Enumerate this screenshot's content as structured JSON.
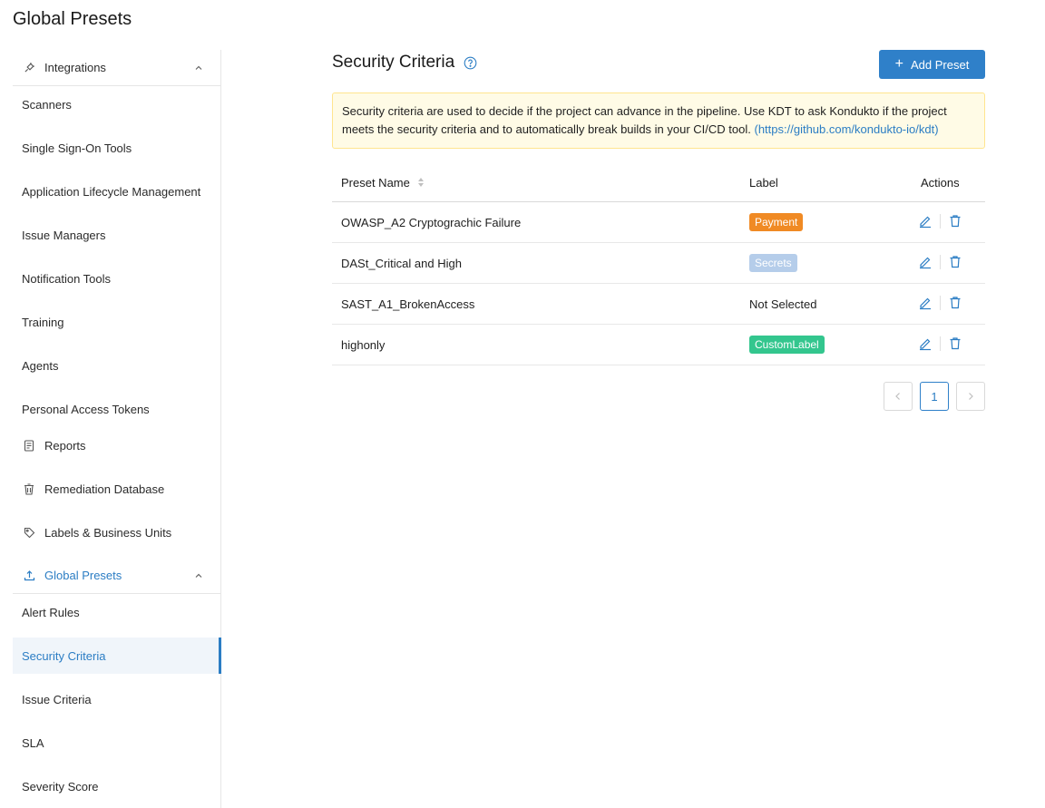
{
  "page": {
    "title": "Global Presets"
  },
  "sidebar": {
    "items": [
      {
        "label": "Integrations",
        "type": "group",
        "icon": "plug-icon"
      },
      {
        "label": "Scanners",
        "type": "sub"
      },
      {
        "label": "Single Sign-On Tools",
        "type": "sub"
      },
      {
        "label": "Application Lifecycle Management",
        "type": "sub"
      },
      {
        "label": "Issue Managers",
        "type": "sub"
      },
      {
        "label": "Notification Tools",
        "type": "sub"
      },
      {
        "label": "Training",
        "type": "sub"
      },
      {
        "label": "Agents",
        "type": "sub"
      },
      {
        "label": "Personal Access Tokens",
        "type": "sub"
      },
      {
        "label": "Reports",
        "type": "top",
        "icon": "report-icon"
      },
      {
        "label": "Remediation Database",
        "type": "top",
        "icon": "database-icon"
      },
      {
        "label": "Labels & Business Units",
        "type": "top",
        "icon": "tag-icon"
      },
      {
        "label": "Global Presets",
        "type": "group",
        "icon": "upload-icon",
        "active": true
      },
      {
        "label": "Alert Rules",
        "type": "sub"
      },
      {
        "label": "Security Criteria",
        "type": "sub",
        "selected": true
      },
      {
        "label": "Issue Criteria",
        "type": "sub"
      },
      {
        "label": "SLA",
        "type": "sub"
      },
      {
        "label": "Severity Score",
        "type": "sub"
      }
    ]
  },
  "main": {
    "title": "Security Criteria",
    "add_button": "Add Preset",
    "alert": {
      "text": "Security criteria are used to decide if the project can advance in the pipeline. Use KDT to ask Kondukto if the project meets the security criteria and to automatically break builds in your CI/CD tool. ",
      "link": "(https://github.com/kondukto-io/kdt)"
    },
    "table": {
      "headers": {
        "name": "Preset Name",
        "label": "Label",
        "actions": "Actions"
      },
      "rows": [
        {
          "name": "OWASP_A2 Cryptograchic Failure",
          "label": "Payment",
          "label_color": "#f08a24"
        },
        {
          "name": "DASt_Critical and High",
          "label": "Secrets",
          "label_color": "#b5cdea"
        },
        {
          "name": "SAST_A1_BrokenAccess",
          "label": "Not Selected",
          "label_color": ""
        },
        {
          "name": "highonly",
          "label": "CustomLabel",
          "label_color": "#33c68e"
        }
      ]
    },
    "pagination": {
      "current": "1",
      "prev": "<",
      "next": ">"
    }
  },
  "colors": {
    "accent": "#2f80c9",
    "alert_bg": "#fffbe6",
    "alert_border": "#ffe58f"
  }
}
